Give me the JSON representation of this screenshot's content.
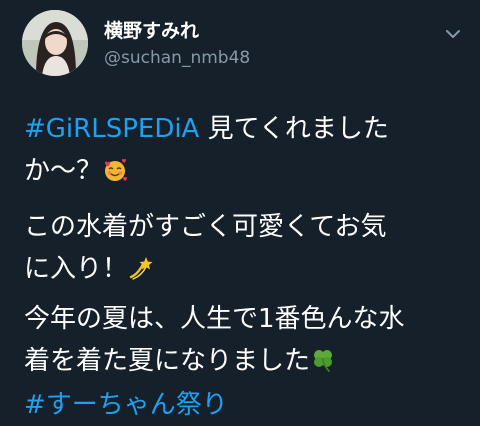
{
  "user": {
    "display_name": "横野すみれ",
    "handle": "@suchan_nmb48"
  },
  "tweet": {
    "p1_hashtag": "#GiRLSPEDiA",
    "p1_line1_rest": " 見てくれました",
    "p1_line2": "か〜？",
    "p1_emoji": "smiling-face-with-hearts-icon",
    "p2_line1": "この水着がすごく可愛くてお気",
    "p2_line2": "に入り！",
    "p2_emoji": "dizzy-star-icon",
    "p3_line1": "今年の夏は、人生で1番色んな水",
    "p3_line2": "着を着た夏になりました",
    "p3_emoji": "four-leaf-clover-icon",
    "p4_hashtag": "#すーちゃん祭り"
  },
  "colors": {
    "background": "#15202b",
    "text": "#ffffff",
    "secondary": "#8899a6",
    "link": "#1da1f2"
  }
}
